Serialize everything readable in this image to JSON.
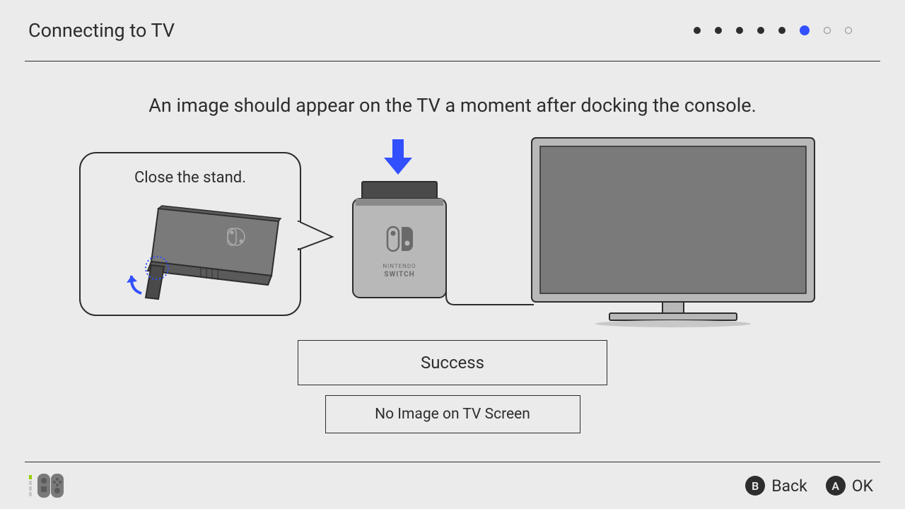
{
  "header": {
    "title": "Connecting to TV",
    "step_total": 8,
    "step_current": 6
  },
  "instruction": "An image should appear on the TV a moment after docking the console.",
  "callout": {
    "text": "Close the stand."
  },
  "dock": {
    "brand_top": "NINTENDO",
    "brand_bottom": "SWITCH"
  },
  "buttons": {
    "success": "Success",
    "no_image": "No Image on TV Screen"
  },
  "footer": {
    "back_label": "Back",
    "back_button": "B",
    "ok_label": "OK",
    "ok_button": "A"
  }
}
